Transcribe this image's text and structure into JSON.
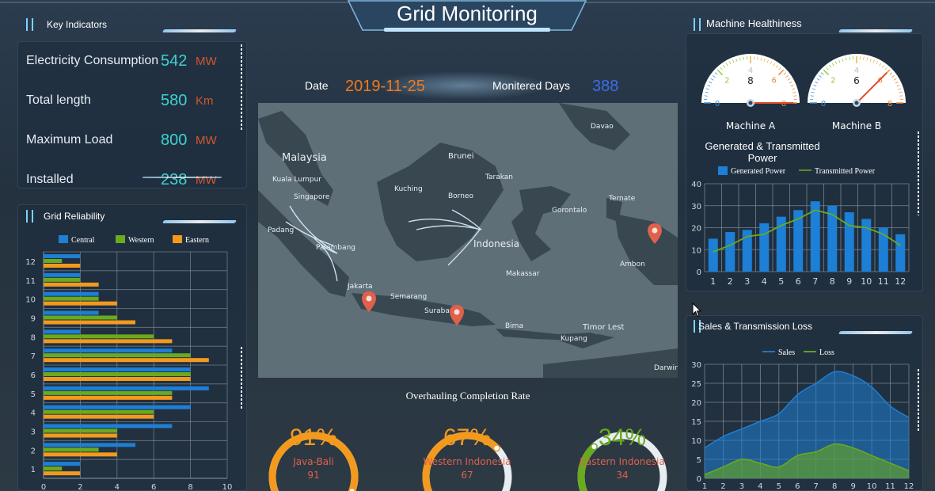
{
  "header": {
    "title": "Grid Monitoring"
  },
  "key_indicators": {
    "title": "Key Indicators",
    "items": [
      {
        "label": "Electricity Consumption",
        "value": "542",
        "unit": "MW"
      },
      {
        "label": "Total length",
        "value": "580",
        "unit": "Km"
      },
      {
        "label": "Maximum Load",
        "value": "800",
        "unit": "MW"
      },
      {
        "label": "Installed",
        "value": "238",
        "unit": "MW"
      }
    ]
  },
  "date_bar": {
    "date_label": "Date",
    "date_value": "2019-11-25",
    "days_label": "Monitered Days",
    "days_value": "388"
  },
  "map": {
    "labels": [
      "Malaysia",
      "Kuala Lumpur",
      "Singapore",
      "Brunei",
      "Kuching",
      "Borneo",
      "Tarakan",
      "Davao",
      "Ternate",
      "Gorontalo",
      "Padang",
      "Palembang",
      "Indonesia",
      "Makassar",
      "Ambon",
      "Jakarta",
      "Semarang",
      "Surabaya",
      "Bima",
      "Timor Lest",
      "Kupang",
      "Darwin"
    ],
    "pins": [
      "Java-Bali",
      "Western Indonesia",
      "Eastern Indonesia"
    ]
  },
  "colors": {
    "accent": "#3ed1d1",
    "orange": "#f39a1e",
    "green": "#6aaa1e",
    "blue": "#1d7fd6",
    "unit": "#d2572c",
    "date": "#f07a1e",
    "days": "#3a6fe8"
  },
  "grid_reliability": {
    "title": "Grid Reliability",
    "chart_data": {
      "type": "bar",
      "categories": [
        "1",
        "2",
        "3",
        "4",
        "5",
        "6",
        "7",
        "8",
        "9",
        "10",
        "11",
        "12"
      ],
      "series": [
        {
          "name": "Central",
          "values": [
            2,
            5,
            7,
            8,
            9,
            8,
            7,
            2,
            3,
            3,
            2,
            2
          ],
          "color": "#1d7fd6"
        },
        {
          "name": "Western",
          "values": [
            1,
            3,
            4,
            6,
            7,
            8,
            8,
            6,
            4,
            3,
            2,
            1
          ],
          "color": "#6aaa1e"
        },
        {
          "name": "Eastern",
          "values": [
            2,
            4,
            4,
            6,
            7,
            8,
            9,
            7,
            5,
            4,
            3,
            2
          ],
          "color": "#f39a1e"
        }
      ],
      "xlim": [
        0,
        10
      ],
      "xticks": [
        "0",
        "2",
        "4",
        "6",
        "8",
        "10"
      ],
      "orientation": "horizontal"
    }
  },
  "gauges": {
    "title": "Machine Healthiness",
    "items": [
      {
        "name": "Machine A",
        "value": 8,
        "max": 8,
        "ticks": [
          "0",
          "2",
          "4",
          "6",
          "8"
        ]
      },
      {
        "name": "Machine B",
        "value": 6,
        "max": 8,
        "ticks": [
          "0",
          "2",
          "4",
          "6",
          "8"
        ]
      }
    ]
  },
  "power_chart": {
    "title_line1": "Generated & Transmitted",
    "title_line2": "Power",
    "chart_data": {
      "type": "bar",
      "categories": [
        "1",
        "2",
        "3",
        "4",
        "5",
        "6",
        "7",
        "8",
        "9",
        "10",
        "11",
        "12"
      ],
      "series": [
        {
          "name": "Generated Power",
          "values": [
            15,
            18,
            19,
            22,
            25,
            28,
            32,
            30,
            27,
            24,
            20,
            17
          ],
          "color": "#1d7fd6",
          "kind": "bar"
        },
        {
          "name": "Transmitted Power",
          "values": [
            9,
            12,
            16,
            17,
            21,
            24,
            28,
            26,
            21,
            20,
            17,
            12
          ],
          "color": "#6aaa1e",
          "kind": "line"
        }
      ],
      "ylim": [
        0,
        40
      ],
      "yticks": [
        "0",
        "10",
        "20",
        "30",
        "40"
      ]
    }
  },
  "sales_chart": {
    "title": "Sales & Transmission Loss",
    "chart_data": {
      "type": "area",
      "x": [
        1,
        2,
        3,
        4,
        5,
        6,
        7,
        8,
        9,
        10,
        11,
        12
      ],
      "series": [
        {
          "name": "Sales",
          "values": [
            8,
            11,
            13,
            15,
            17,
            22,
            25,
            28,
            27,
            24,
            19,
            16
          ],
          "color": "#1d7fd6"
        },
        {
          "name": "Loss",
          "values": [
            1,
            3,
            5,
            4,
            3,
            6,
            7,
            9,
            8,
            6,
            4,
            2
          ],
          "color": "#6aaa1e"
        }
      ],
      "ylim": [
        0,
        30
      ],
      "yticks": [
        "0",
        "5",
        "10",
        "15",
        "20",
        "25",
        "30"
      ],
      "xticks": [
        "1",
        "2",
        "3",
        "4",
        "5",
        "6",
        "7",
        "8",
        "9",
        "10",
        "11",
        "12"
      ]
    }
  },
  "completion": {
    "title": "Overhauling Completion Rate",
    "items": [
      {
        "percent_text": "91%",
        "percent": 91,
        "name": "Java-Bali",
        "number": "91",
        "color": "#f39a1e"
      },
      {
        "percent_text": "67%",
        "percent": 67,
        "name": "Western Indonesia",
        "number": "67",
        "color": "#f39a1e"
      },
      {
        "percent_text": "34%",
        "percent": 34,
        "name": "Eastern Indonesia",
        "number": "34",
        "color": "#6aaa1e"
      }
    ]
  }
}
